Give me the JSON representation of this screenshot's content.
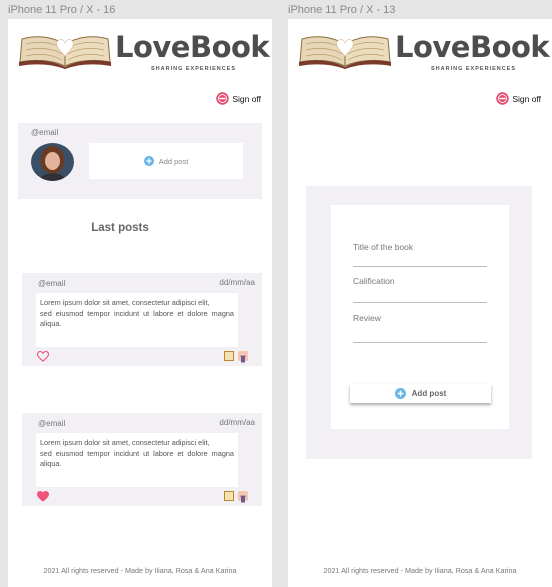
{
  "frames": [
    {
      "label": "iPhone 11 Pro / X - 16",
      "logo": {
        "title": "LoveBook",
        "subtitle": "SHARING EXPERIENCES"
      },
      "sign_off": "Sign off",
      "profile": {
        "email": "@email",
        "add_post": "Add post"
      },
      "section_title": "Last posts",
      "posts": [
        {
          "email": "@email",
          "date": "dd/mm/aa",
          "lines": [
            "Lorem ipsum dolor sit amet, consectetur adipisci elit,",
            "sed eiusmod tempor incidunt  ut labore et dolore magna aliqua."
          ],
          "liked": false
        },
        {
          "email": "@email",
          "date": "dd/mm/aa",
          "lines": [
            "Lorem ipsum dolor sit amet, consectetur adipisci elit,",
            "sed eiusmod tempor incidunt  ut labore et dolore magna aliqua."
          ],
          "liked": true
        }
      ],
      "footer": "2021 All rights reserved - Made by Iliana, Rosa & Ana Karina"
    },
    {
      "label": "iPhone 11 Pro / X - 13",
      "logo": {
        "title": "LoveBook",
        "subtitle": "SHARING EXPERIENCES"
      },
      "sign_off": "Sign off",
      "form": {
        "title_label": "Title of the book",
        "calification_label": "Calification",
        "review_label": "Review",
        "add_post": "Add post"
      },
      "footer": "2021 All rights reserved - Made by Iliana, Rosa & Ana Karina"
    }
  ],
  "icons": {
    "sign_off": "power-icon",
    "add": "plus-circle-icon",
    "like": "heart-icon",
    "edit": "edit-icon",
    "delete": "trash-icon"
  },
  "colors": {
    "accent_blue": "#68b4e6",
    "heart_pink": "#f0537a",
    "panel": "#f2f0f4",
    "logo_text": "#4d4d4d"
  }
}
